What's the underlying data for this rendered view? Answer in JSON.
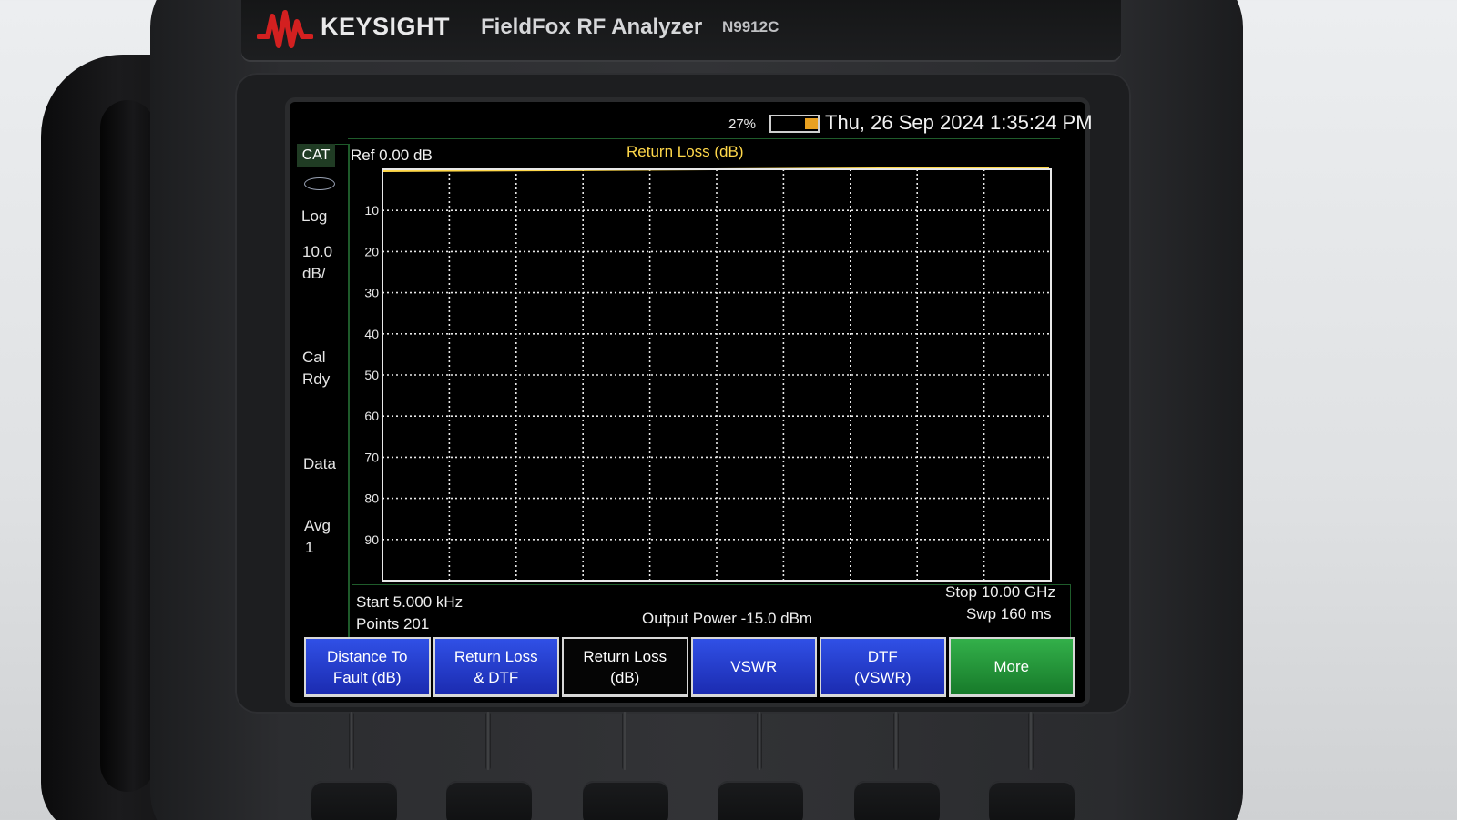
{
  "device": {
    "brand": "KEYSIGHT",
    "product": "FieldFox RF Analyzer",
    "model": "N9912C"
  },
  "status_bar": {
    "battery_percent": "27%",
    "battery_level": 0.27,
    "datetime": "Thu, 26 Sep 2024 1:35:24 PM"
  },
  "left_panel": {
    "mode_tab": "CAT",
    "scale_type": "Log",
    "scale_value": "10.0",
    "scale_unit": "dB/",
    "cal_line1": "Cal",
    "cal_line2": "Rdy",
    "data_label": "Data",
    "avg_label": "Avg",
    "avg_value": "1"
  },
  "plot": {
    "ref_label": "Ref 0.00 dB",
    "trace_title": "Return Loss (dB)",
    "y_ticks": [
      "10",
      "20",
      "30",
      "40",
      "50",
      "60",
      "70",
      "80",
      "90"
    ]
  },
  "bottom_info": {
    "start": "Start 5.000 kHz",
    "points": "Points 201",
    "output_power": "Output Power -15.0 dBm",
    "stop": "Stop 10.00 GHz",
    "sweep": "Swp 160 ms"
  },
  "softkeys": [
    {
      "label": "Distance To\nFault (dB)",
      "style": "blue"
    },
    {
      "label": "Return Loss\n& DTF",
      "style": "blue"
    },
    {
      "label": "Return Loss\n(dB)",
      "style": "black"
    },
    {
      "label": "VSWR",
      "style": "blue"
    },
    {
      "label": "DTF\n(VSWR)",
      "style": "blue"
    },
    {
      "label": "More",
      "style": "green"
    }
  ],
  "colors": {
    "trace": "#ffd84a",
    "grid": "#e8e8e8",
    "frame_green": "#1f5c2b",
    "logo_red": "#d32020"
  }
}
